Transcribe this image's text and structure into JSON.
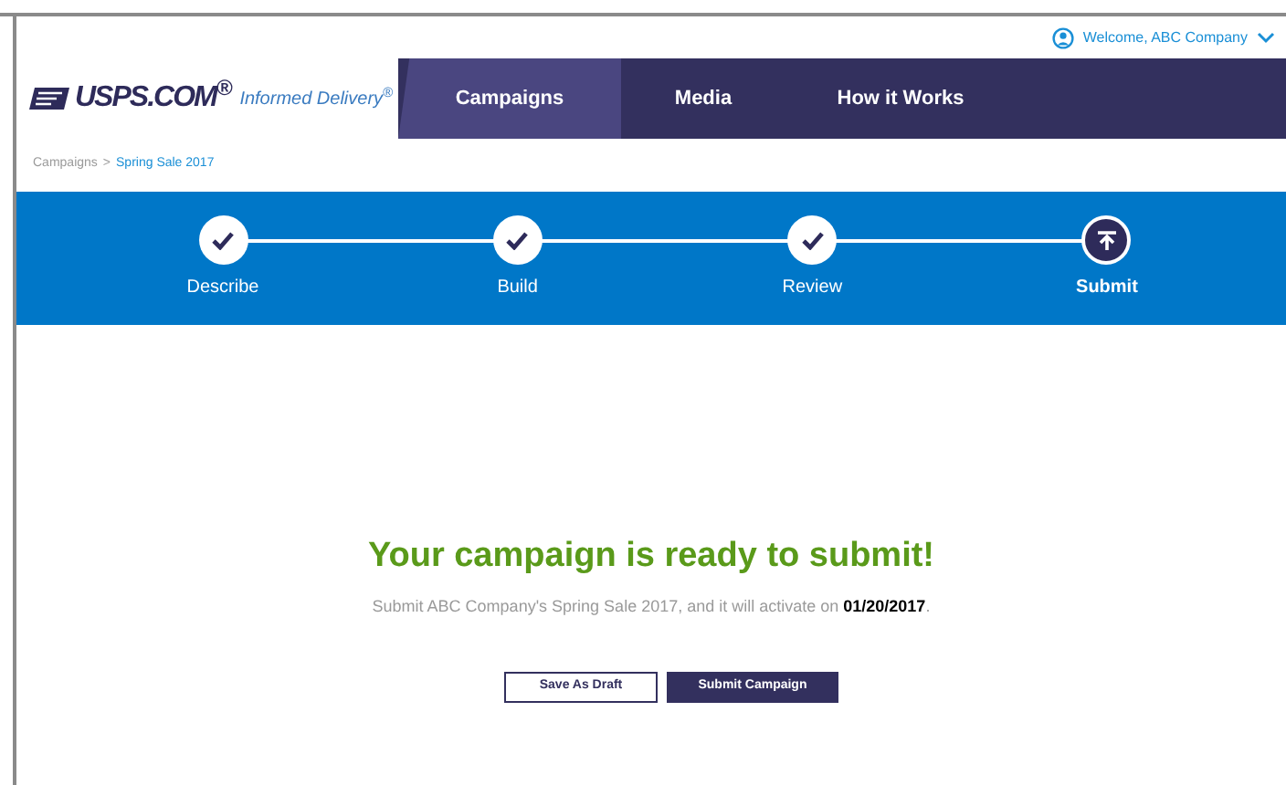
{
  "header": {
    "welcome": "Welcome, ABC Company",
    "logo": {
      "brand": "USPS.COM$^{®}$",
      "product": "Informed Delivery$^{®}$"
    },
    "nav": [
      {
        "label": "Campaigns",
        "selected": true
      },
      {
        "label": "Media",
        "selected": false
      },
      {
        "label": "How it Works",
        "selected": false
      }
    ]
  },
  "breadcrumb": {
    "items": [
      "Campaigns",
      "Spring Sale 2017"
    ],
    "separator": ">"
  },
  "steps": [
    {
      "label": "Describe",
      "completed": true
    },
    {
      "label": "Build",
      "completed": true
    },
    {
      "label": "Review",
      "completed": true
    },
    {
      "label": "Submit",
      "completed": false
    }
  ],
  "message": {
    "title": "Your campaign is ready to submit!",
    "text": "Submit ABC Company's Spring Sale 2017, and it will activate on **01/20/2017**."
  },
  "buttons": [
    {
      "label": "Save As Draft",
      "kind": "secondary"
    },
    {
      "label": "Submit Campaign",
      "kind": "primary"
    }
  ]
}
